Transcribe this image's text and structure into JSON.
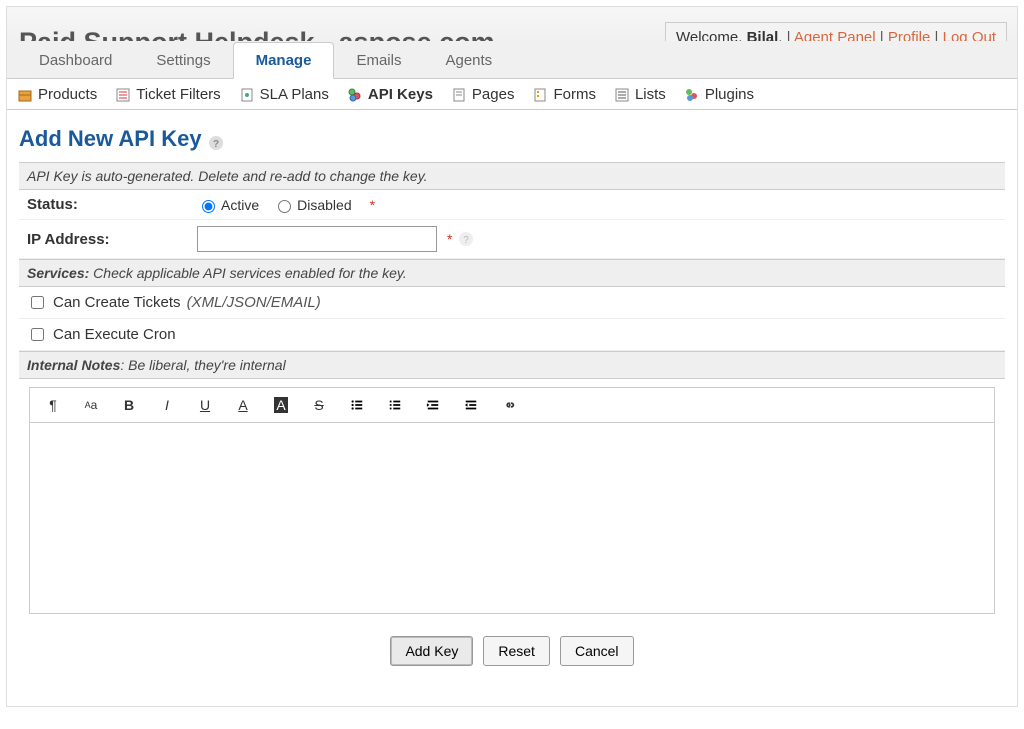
{
  "header": {
    "title": "Paid Support Helpdesk - aspose.com",
    "welcome_prefix": "Welcome, ",
    "user_name": "Bilal",
    "links": {
      "agent_panel": "Agent Panel",
      "profile": "Profile",
      "logout": "Log Out"
    }
  },
  "tabs": [
    {
      "label": "Dashboard",
      "active": false
    },
    {
      "label": "Settings",
      "active": false
    },
    {
      "label": "Manage",
      "active": true
    },
    {
      "label": "Emails",
      "active": false
    },
    {
      "label": "Agents",
      "active": false
    }
  ],
  "subnav": [
    {
      "label": "Products",
      "active": false,
      "icon": "box"
    },
    {
      "label": "Ticket Filters",
      "active": false,
      "icon": "filter"
    },
    {
      "label": "SLA Plans",
      "active": false,
      "icon": "doc"
    },
    {
      "label": "API Keys",
      "active": true,
      "icon": "key"
    },
    {
      "label": "Pages",
      "active": false,
      "icon": "page"
    },
    {
      "label": "Forms",
      "active": false,
      "icon": "form"
    },
    {
      "label": "Lists",
      "active": false,
      "icon": "list"
    },
    {
      "label": "Plugins",
      "active": false,
      "icon": "plugin"
    }
  ],
  "page": {
    "title": "Add New API Key",
    "banner": "API Key is auto-generated. Delete and re-add to change the key.",
    "status_label": "Status:",
    "status_options": {
      "active": "Active",
      "disabled": "Disabled"
    },
    "status_value": "active",
    "ip_label": "IP Address:",
    "ip_value": "",
    "services_label": "Services:",
    "services_hint": "Check applicable API services enabled for the key.",
    "services": [
      {
        "label": "Can Create Tickets",
        "suffix": "(XML/JSON/EMAIL)",
        "checked": false
      },
      {
        "label": "Can Execute Cron",
        "suffix": "",
        "checked": false
      }
    ],
    "notes_label": "Internal Notes",
    "notes_hint": ": Be liberal, they're internal",
    "buttons": {
      "add": "Add Key",
      "reset": "Reset",
      "cancel": "Cancel"
    }
  }
}
